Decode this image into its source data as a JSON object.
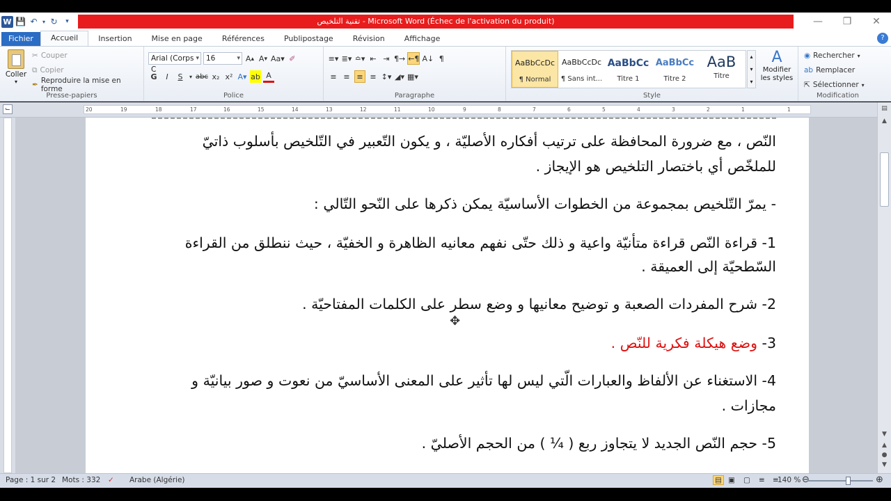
{
  "titlebar": {
    "title": "تقنية التلخيص  -  Microsoft Word (Échec de l'activation du produit)",
    "app_icon_letter": "W"
  },
  "tabs": [
    "Fichier",
    "Accueil",
    "Insertion",
    "Mise en page",
    "Références",
    "Publipostage",
    "Révision",
    "Affichage"
  ],
  "clipboard": {
    "paste": "Coller",
    "cut": "Couper",
    "copy": "Copier",
    "format_painter": "Reproduire la mise en forme",
    "label": "Presse-papiers"
  },
  "font": {
    "name": "Arial (Corps C",
    "size": "16",
    "bold": "G",
    "italic": "I",
    "underline": "S",
    "strike": "abc",
    "sub": "x₂",
    "sup": "x²",
    "label": "Police"
  },
  "paragraph": {
    "label": "Paragraphe"
  },
  "styles": {
    "items": [
      {
        "sample": "AaBbCcDc",
        "name": "¶ Normal"
      },
      {
        "sample": "AaBbCcDc",
        "name": "¶ Sans int..."
      },
      {
        "sample": "AaBbCc",
        "name": "Titre 1"
      },
      {
        "sample": "AaBbCc",
        "name": "Titre 2"
      },
      {
        "sample": "AaB",
        "name": "Titre"
      }
    ],
    "modify": "Modifier les styles",
    "label": "Style"
  },
  "editing": {
    "find": "Rechercher",
    "replace": "Remplacer",
    "select": "Sélectionner",
    "label": "Modification"
  },
  "ruler_ticks": [
    "20",
    "19",
    "18",
    "17",
    "16",
    "15",
    "14",
    "13",
    "12",
    "11",
    "10",
    "9",
    "8",
    "7",
    "6",
    "5",
    "4",
    "3",
    "2",
    "1",
    "1"
  ],
  "document": {
    "lines": [
      "النّص ، مع ضرورة المحافظة على ترتيب أفكاره الأصليّة ، و يكون التّعبير في التّلخيص بأسلوب ذاتيّ",
      "للملخّص أي باختصار التلخيص هو الإيجاز .",
      "- يمرّ التّلخيص بمجموعة من الخطوات الأساسيّة يمكن ذكرها على النّحو التّالي :",
      "1- قراءة النّص قراءة متأنيّة واعية و ذلك حتّى نفهم معانيه الظاهرة و الخفيّة ، حيث ننطلق من القراءة",
      "السّطحيّة إلى العميقة .",
      "2- شرح المفردات الصعبة  و توضيح معانيها و وضع  سطر على الكلمات المفتاحيّة .",
      "3- ",
      "وضع هيكلة فكرية للنّص .",
      "4- الاستغناء عن الألفاظ والعبارات الّتي ليس لها تأثير على المعنى الأساسيّ من نعوت و صور بيانيّة و",
      "مجازات .",
      "5- حجم النّص الجديد لا يتجاوز ربع  ( ¼ ) من الحجم الأصليّ ."
    ]
  },
  "status": {
    "page": "Page : 1 sur 2",
    "words": "Mots : 332",
    "language": "Arabe (Algérie)",
    "zoom": "140 %"
  },
  "colors": {
    "title_bar_alert": "#e81c1c",
    "file_tab": "#2b6cc4",
    "red_text": "#d11111"
  }
}
